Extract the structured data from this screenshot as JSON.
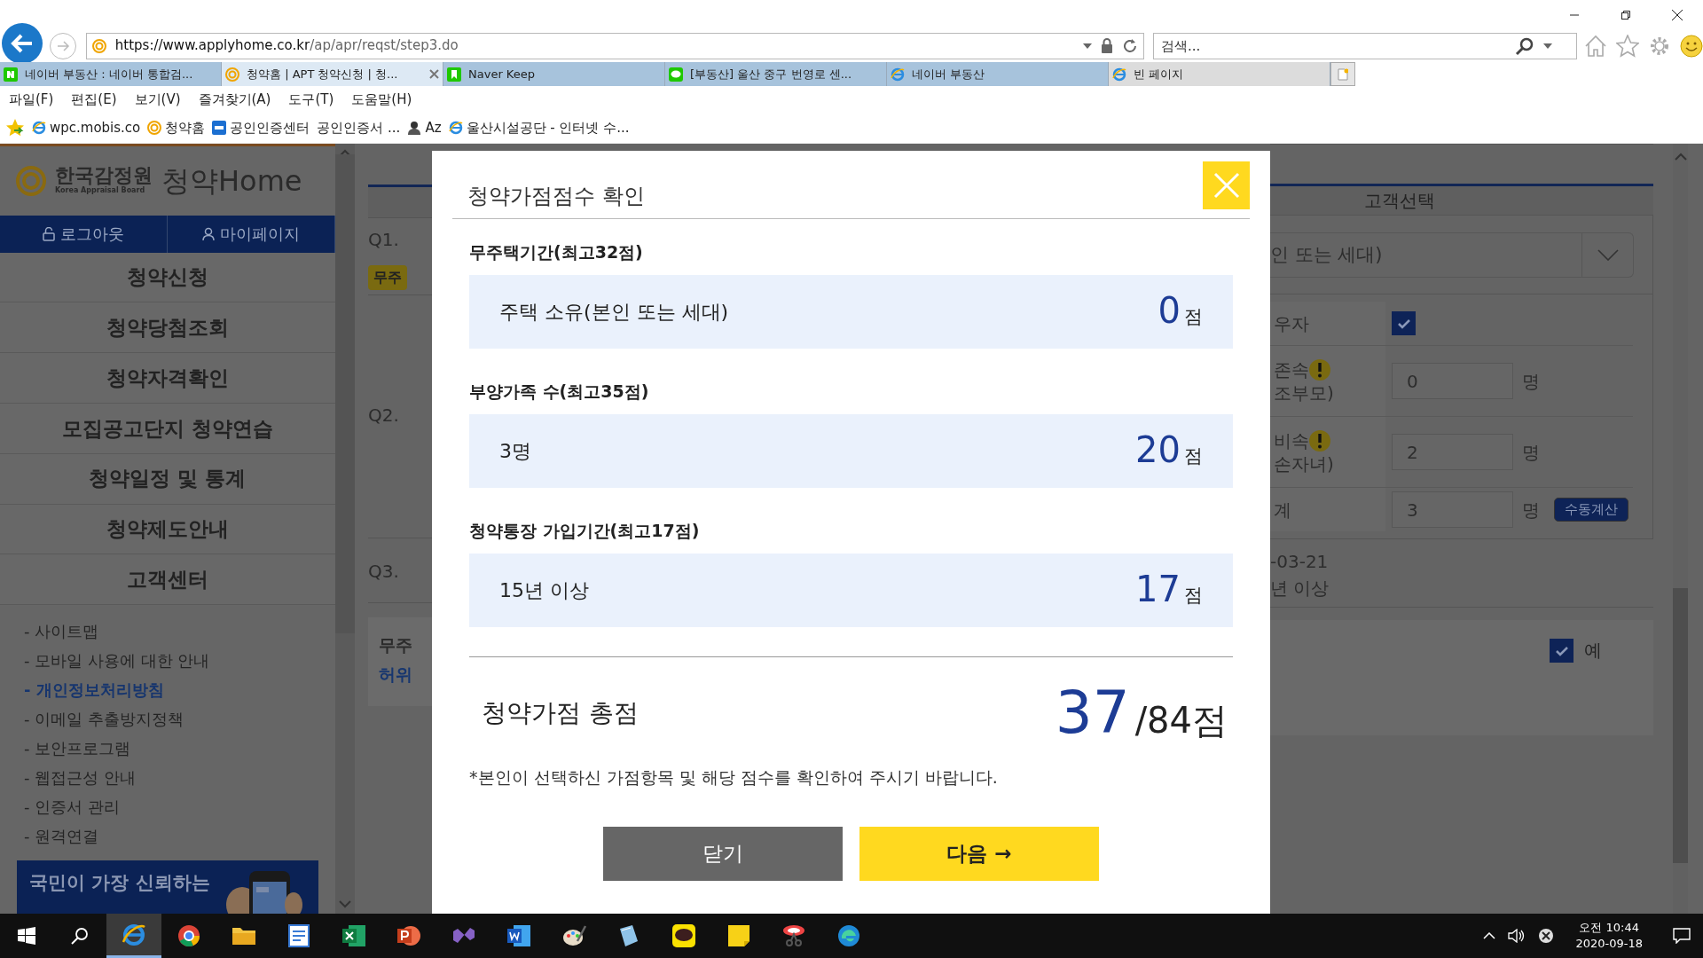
{
  "browser": {
    "address": {
      "host": "https://www.applyhome.co.kr",
      "path": "/ap/apr/reqst/step3.do"
    },
    "search": {
      "placeholder": "검색..."
    },
    "tabs": [
      {
        "label": "네이버 부동산 : 네이버 통합검...",
        "kind": "naver",
        "grouped": true,
        "selected": false
      },
      {
        "label": "청약홈 | APT 청약신청 | 청...",
        "kind": "applyhome",
        "grouped": true,
        "selected": true
      },
      {
        "label": "Naver Keep",
        "kind": "keep",
        "grouped": true,
        "selected": false
      },
      {
        "label": "[부동산] 울산 중구 번영로 센...",
        "kind": "line",
        "grouped": true,
        "selected": false
      },
      {
        "label": "네이버 부동산",
        "kind": "ie",
        "grouped": true,
        "selected": false
      },
      {
        "label": "빈 페이지",
        "kind": "ie",
        "grouped": false,
        "selected": false
      }
    ],
    "menu": [
      "파일(F)",
      "편집(E)",
      "보기(V)",
      "즐겨찾기(A)",
      "도구(T)",
      "도움말(H)"
    ],
    "favorites": [
      {
        "label": "wpc.mobis.co",
        "kind": "ie"
      },
      {
        "label": "청약홈",
        "kind": "applyhome"
      },
      {
        "label": "공인인증센터",
        "kind": "nh"
      },
      {
        "label": "공인인증서 ...",
        "kind": "none"
      },
      {
        "label": "Az",
        "kind": "person"
      },
      {
        "label": "울산시설공단 - 인터넷 수...",
        "kind": "ie"
      }
    ]
  },
  "sidebar": {
    "logo": {
      "org": "한국감정원",
      "org_en": "Korea Appraisal Board",
      "brand": "청약Home"
    },
    "auth": [
      {
        "label": "로그아웃",
        "kind": "lock"
      },
      {
        "label": "마이페이지",
        "kind": "person"
      }
    ],
    "nav": [
      "청약신청",
      "청약당첨조회",
      "청약자격확인",
      "모집공고단지 청약연습",
      "청약일정 및 통계",
      "청약제도안내",
      "고객센터"
    ],
    "links": [
      {
        "label": "- 사이트맵",
        "highlighted": false
      },
      {
        "label": "- 모바일 사용에 대한 안내",
        "highlighted": false
      },
      {
        "label": "- 개인정보처리방침",
        "highlighted": true
      },
      {
        "label": "- 이메일 추출방지정책",
        "highlighted": false
      },
      {
        "label": "- 보안프로그램",
        "highlighted": false
      },
      {
        "label": "- 웹접근성 안내",
        "highlighted": false
      },
      {
        "label": "- 인증서 관리",
        "highlighted": false
      },
      {
        "label": "- 원격연결",
        "highlighted": false
      }
    ],
    "banner": {
      "text": "국민이 가장 신뢰하는",
      "kind": "picture"
    }
  },
  "background": {
    "left": {
      "q1": "Q1.",
      "badge": "무주",
      "q2": "Q2.",
      "q3": "Q3.",
      "notice": [
        "무주",
        "허위"
      ]
    },
    "right": {
      "header": "고객선택",
      "select": "인 또는 세대)",
      "rows": [
        {
          "kind": "checkbox",
          "label": [
            "우자"
          ],
          "checked": true
        },
        {
          "kind": "count",
          "label": [
            "존속",
            "조부모)"
          ],
          "warn": true,
          "value": "0",
          "unit": "명"
        },
        {
          "kind": "count",
          "label": [
            "비속",
            "손자녀)"
          ],
          "warn": true,
          "value": "2",
          "unit": "명"
        },
        {
          "kind": "count",
          "label": [
            "계"
          ],
          "warn": false,
          "value": "3",
          "unit": "명",
          "button": "수동계산"
        }
      ],
      "date": "-03-21",
      "period": "년 이상",
      "agree": {
        "label": "예",
        "checked": true
      }
    }
  },
  "modal": {
    "title": "청약가점점수 확인",
    "sections": [
      {
        "label": "무주택기간(최고32점)",
        "answer": "주택 소유(본인 또는 세대)",
        "score": "0",
        "unit": "점"
      },
      {
        "label": "부양가족 수(최고35점)",
        "answer": "3명",
        "score": "20",
        "unit": "점"
      },
      {
        "label": "청약통장 가입기간(최고17점)",
        "answer": "15년 이상",
        "score": "17",
        "unit": "점"
      }
    ],
    "total": {
      "label": "청약가점 총점",
      "score": "37",
      "max": "/84점"
    },
    "note": "*본인이 선택하신 가점항목 및 해당 점수를 확인하여 주시기 바랍니다.",
    "buttons": [
      {
        "label": "닫기",
        "kind": "secondary"
      },
      {
        "label": "다음 →",
        "kind": "primary"
      }
    ]
  },
  "taskbar": {
    "apps": [
      {
        "kind": "ie",
        "selected": true
      },
      {
        "kind": "chrome",
        "selected": false
      },
      {
        "kind": "folder",
        "selected": false
      },
      {
        "kind": "notepad",
        "selected": false
      },
      {
        "kind": "excel",
        "selected": false
      },
      {
        "kind": "powerpoint",
        "selected": false
      },
      {
        "kind": "vs",
        "selected": false
      },
      {
        "kind": "word",
        "selected": false
      },
      {
        "kind": "paint",
        "selected": false
      },
      {
        "kind": "book",
        "selected": false
      },
      {
        "kind": "talk",
        "selected": false
      },
      {
        "kind": "sticky",
        "selected": false
      },
      {
        "kind": "snip",
        "selected": false
      },
      {
        "kind": "edge",
        "selected": false
      }
    ],
    "time": "오전 10:44",
    "date": "2020-09-18"
  }
}
